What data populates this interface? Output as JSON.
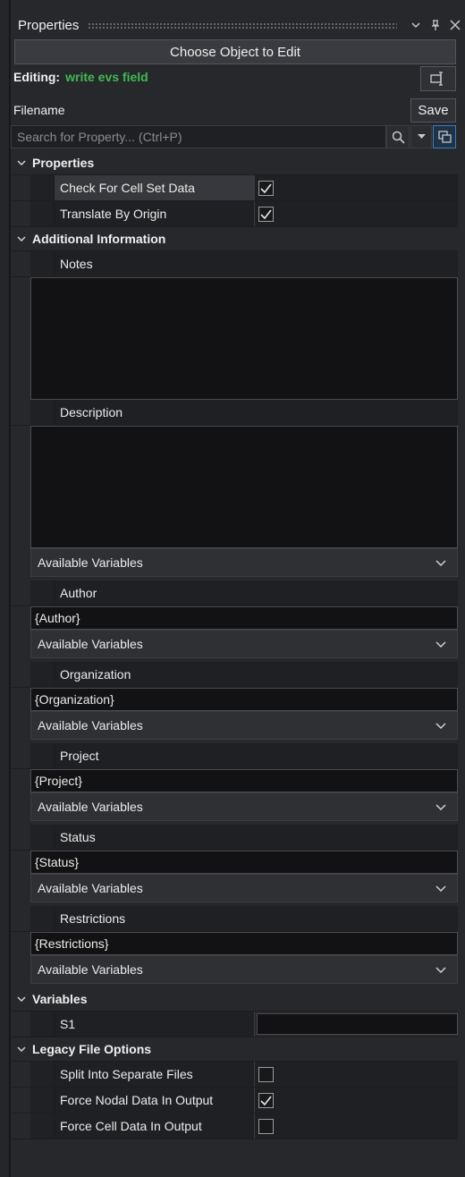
{
  "title": "Properties",
  "choose_label": "Choose Object to Edit",
  "editing_label": "Editing:",
  "editing_value": "write evs field",
  "filename_label": "Filename",
  "save_label": "Save",
  "search_placeholder": "Search for Property...  (Ctrl+P)",
  "accent_green": "#3fb950",
  "cat_properties": "Properties",
  "check_cell_set": "Check For Cell Set Data",
  "translate_origin": "Translate By Origin",
  "cat_additional": "Additional Information",
  "notes_label": "Notes",
  "description_label": "Description",
  "avail_vars": "Available Variables",
  "author_label": "Author",
  "author_value": "{Author}",
  "organization_label": "Organization",
  "organization_value": "{Organization}",
  "project_label": "Project",
  "project_value": "{Project}",
  "status_label": "Status",
  "status_value": "{Status}",
  "restrictions_label": "Restrictions",
  "restrictions_value": "{Restrictions}",
  "cat_variables": "Variables",
  "s1_label": "S1",
  "cat_legacy": "Legacy File Options",
  "split_files": "Split Into Separate Files",
  "force_nodal": "Force Nodal Data In Output",
  "force_cell": "Force Cell Data In Output",
  "checkbox_states": {
    "check_cell_set": true,
    "translate_origin": true,
    "split_files": false,
    "force_nodal": true,
    "force_cell": false
  }
}
